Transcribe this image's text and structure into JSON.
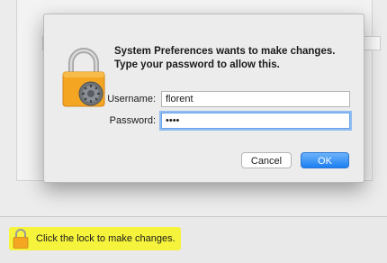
{
  "dialog": {
    "title": "System Preferences wants to make changes. Type your password to allow this.",
    "username_label": "Username:",
    "username_value": "florent",
    "password_label": "Password:",
    "password_value": "••••",
    "cancel_label": "Cancel",
    "ok_label": "OK"
  },
  "lock_hint": {
    "text": "Click the lock to make changes."
  },
  "colors": {
    "accent": "#1d7ff2",
    "highlight": "#f6f33c",
    "lock_body": "#f4a622"
  },
  "icons": {
    "dialog_icon": "lock-with-gear-icon",
    "hint_icon": "padlock-icon"
  }
}
